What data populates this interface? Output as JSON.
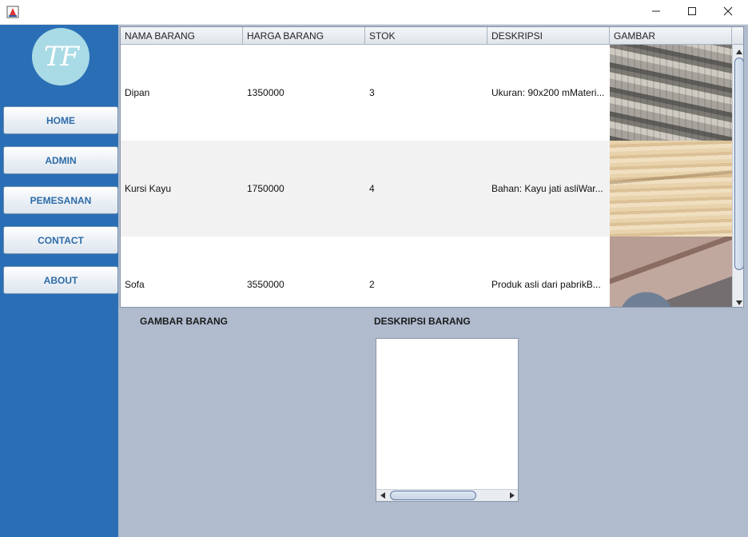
{
  "window": {
    "minimize_icon": "minimize-icon",
    "maximize_icon": "maximize-icon",
    "close_icon": "close-icon"
  },
  "sidebar": {
    "logo_text": "TF",
    "items": [
      {
        "label": "HOME"
      },
      {
        "label": "ADMIN"
      },
      {
        "label": "PEMESANAN"
      },
      {
        "label": "CONTACT"
      },
      {
        "label": "ABOUT"
      }
    ]
  },
  "table": {
    "columns": [
      "NAMA BARANG",
      "HARGA BARANG",
      "STOK",
      "DESKRIPSI",
      "GAMBAR"
    ],
    "rows": [
      {
        "nama": "Dipan",
        "harga": "1350000",
        "stok": "3",
        "deskripsi": "Ukuran: 90x200 mMateri...",
        "gambar": "wooden-bed-image"
      },
      {
        "nama": "Kursi Kayu",
        "harga": "1750000",
        "stok": "4",
        "deskripsi": "Bahan: Kayu jati asliWar...",
        "gambar": "wooden-chair-image"
      },
      {
        "nama": "Sofa",
        "harga": "3550000",
        "stok": "2",
        "deskripsi": "Produk asli dari pabrikB...",
        "gambar": "sofa-image"
      }
    ]
  },
  "details": {
    "gambar_label": "GAMBAR BARANG",
    "deskripsi_label": "DESKRIPSI BARANG",
    "deskripsi_text": ""
  },
  "colors": {
    "sidebar": "#2a6fb5",
    "main_bg": "#b0bbce",
    "nav_text": "#2e6ca8"
  }
}
